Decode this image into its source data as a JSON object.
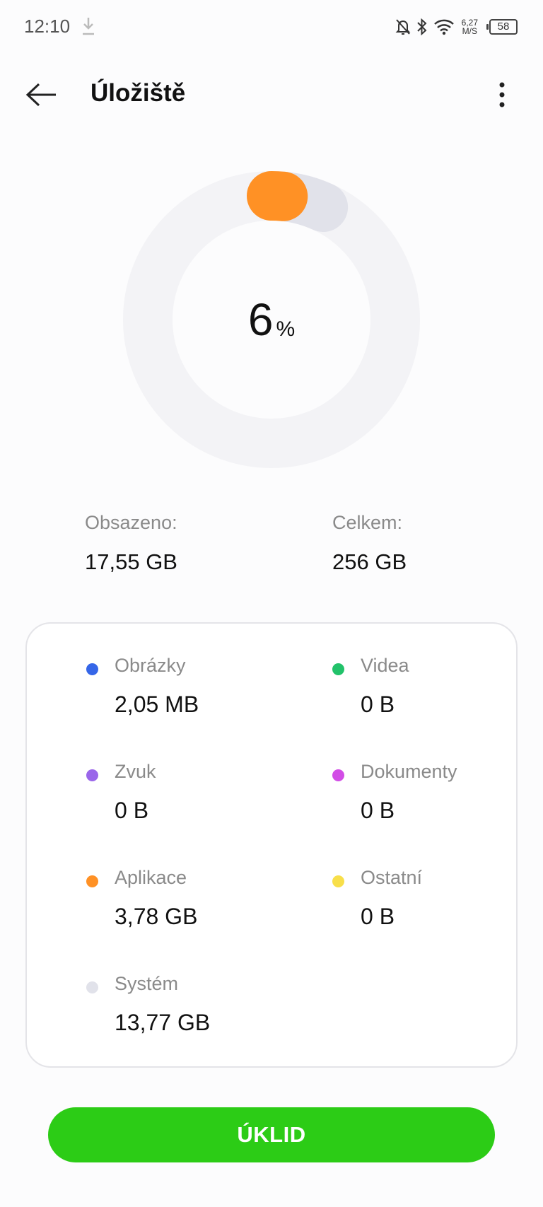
{
  "status_bar": {
    "time": "12:10",
    "net_speed_value": "6,27",
    "net_speed_unit": "M/S",
    "battery_level": "58",
    "icons": [
      "download-icon",
      "bell-muted-icon",
      "bluetooth-icon",
      "wifi-icon",
      "battery-icon"
    ]
  },
  "header": {
    "title": "Úložiště",
    "back_icon": "arrow-left-icon",
    "more_icon": "more-vertical-icon"
  },
  "usage_ring": {
    "percent_value": "6",
    "percent_sign": "%",
    "segments": [
      {
        "name": "Aplikace",
        "fraction": 0.0148,
        "color": "#ff9125"
      },
      {
        "name": "Systém",
        "fraction": 0.0538,
        "color": "#e1e2ea"
      }
    ],
    "track_color": "#f3f3f6"
  },
  "totals": {
    "used_label": "Obsazeno:",
    "used_value": "17,55 GB",
    "total_label": "Celkem:",
    "total_value": "256 GB"
  },
  "categories": [
    {
      "label": "Obrázky",
      "value": "2,05 MB",
      "color": "#3566e8"
    },
    {
      "label": "Videa",
      "value": "0 B",
      "color": "#22c26a"
    },
    {
      "label": "Zvuk",
      "value": "0 B",
      "color": "#9a66ea"
    },
    {
      "label": "Dokumenty",
      "value": "0 B",
      "color": "#d24de6"
    },
    {
      "label": "Aplikace",
      "value": "3,78 GB",
      "color": "#ff9125"
    },
    {
      "label": "Ostatní",
      "value": "0 B",
      "color": "#f8df4a"
    },
    {
      "label": "Systém",
      "value": "13,77 GB",
      "color": "#e1e2ea"
    }
  ],
  "actions": {
    "clean_label": "ÚKLID",
    "clean_color": "#2ccc16"
  }
}
